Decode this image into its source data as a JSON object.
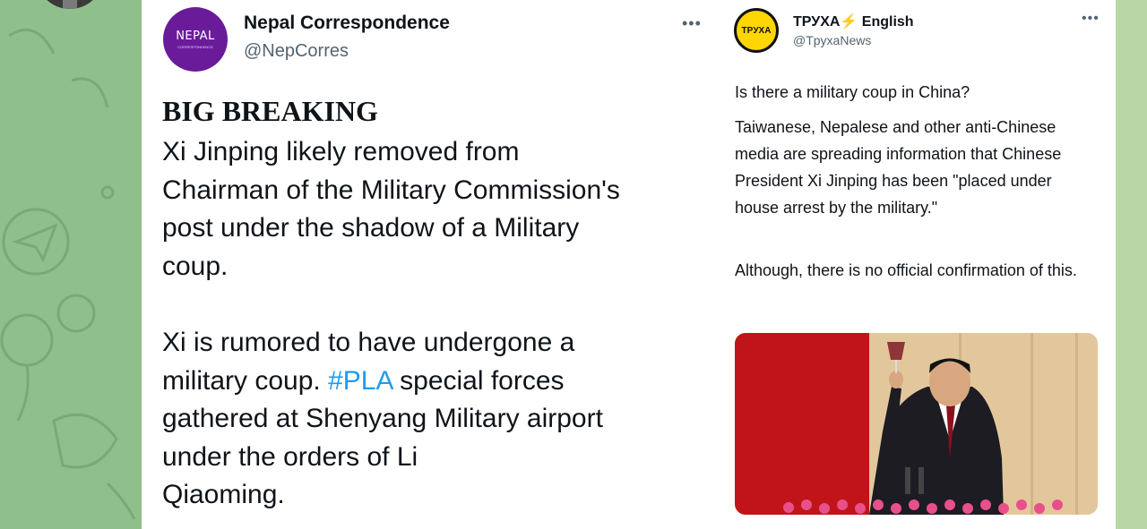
{
  "colors": {
    "background": "#8fbf8a",
    "card": "#ffffff",
    "link": "#1d9bf0",
    "muted": "#536471",
    "nepal_purple": "#6a1b9a",
    "trukha_yellow": "#ffd600"
  },
  "tweet_left": {
    "avatar_text": "NEPAL",
    "avatar_subtext": "CORRESPONDENCE",
    "name": "Nepal Correspondence",
    "handle": "@NepCorres",
    "more_icon": "•••",
    "headline": "BIG BREAKING",
    "para1": "Xi Jinping likely removed from\nChairman of the Military Commission's\npost under the shadow of a Military\ncoup.",
    "para2_pre": "Xi is rumored to have undergone a\nmilitary coup. ",
    "hashtag": "#PLA",
    "para2_post": " special forces\ngathered at Shenyang Military airport\nunder the orders of Li\nQiaoming."
  },
  "tweet_right": {
    "avatar_text": "TPУXA",
    "name": "ТРУХА",
    "bolt": "⚡",
    "name_suffix": " English",
    "handle": "@TpyxaNews",
    "more_icon": "•••",
    "question": "Is there a military coup in China?",
    "para1": "Taiwanese, Nepalese and other anti-Chinese media are spreading information that Chinese President Xi Jinping has been \"placed under house arrest by the military.\"",
    "para2": "Although, there is no official confirmation of this."
  }
}
